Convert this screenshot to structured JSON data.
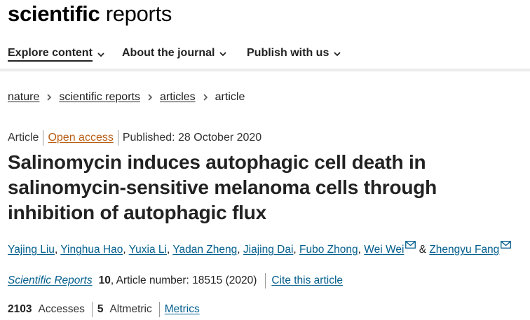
{
  "logo": {
    "bold": "scientific",
    "regular": " reports"
  },
  "nav": [
    {
      "label": "Explore content"
    },
    {
      "label": "About the journal"
    },
    {
      "label": "Publish with us"
    }
  ],
  "breadcrumb": [
    {
      "label": "nature"
    },
    {
      "label": "scientific reports"
    },
    {
      "label": "articles"
    },
    {
      "label": "article"
    }
  ],
  "article": {
    "type": "Article",
    "access": "Open access",
    "published": "Published: 28 October 2020",
    "title": "Salinomycin induces autophagic cell death in salinomycin-sensitive melanoma cells through inhibition of autophagic flux",
    "authors": [
      "Yajing Liu",
      "Yinghua Hao",
      "Yuxia Li",
      "Yadan Zheng",
      "Jiajing Dai",
      "Fubo Zhong",
      "Wei Wei",
      "Zhengyu Fang"
    ],
    "separator": ", ",
    "ampersand": " & ",
    "journal": "Scientific Reports",
    "volume": "10",
    "article_number": ", Article number: 18515 (2020)",
    "cite_label": "Cite this article",
    "accesses_count": "2103",
    "accesses_label": "Accesses",
    "altmetric_count": "5",
    "altmetric_label": "Altmetric",
    "metrics_label": "Metrics"
  },
  "colors": {
    "link": "#025e8d",
    "open_access": "#b85d13",
    "text": "#222222",
    "divider": "#ebebeb"
  },
  "icons": {
    "nav_dropdown": "chevron-down-icon",
    "breadcrumb_separator": "chevron-right-icon",
    "author_contact": "mail-icon"
  }
}
